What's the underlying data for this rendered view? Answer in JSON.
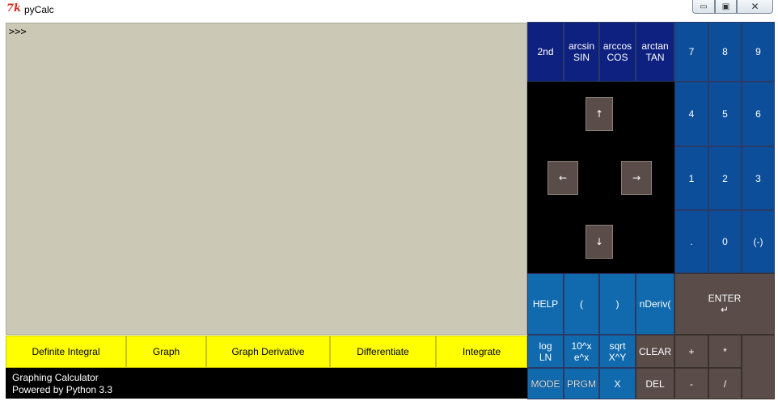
{
  "window": {
    "logo": "7k",
    "title": "pyCalc",
    "minimize_icon": "minimize-icon",
    "maximize_icon": "maximize-icon",
    "close_icon": "close-icon",
    "min_glyph": "▭",
    "max_glyph": "▣",
    "close_glyph": "✕"
  },
  "console": {
    "prompt": ">>>"
  },
  "functions": [
    "Definite Integral",
    "Graph",
    "Graph Derivative",
    "Differentiate",
    "Integrate"
  ],
  "footer": {
    "line1": "Graphing Calculator",
    "line2": "Powered by Python 3.3"
  },
  "keypad": {
    "second": "2nd",
    "arcsin": {
      "top": "arcsin",
      "bottom": "SIN"
    },
    "arccos": {
      "top": "arccos",
      "bottom": "COS"
    },
    "arctan": {
      "top": "arctan",
      "bottom": "TAN"
    },
    "digits": [
      "7",
      "8",
      "9",
      "4",
      "5",
      "6",
      "1",
      "2",
      "3",
      ".",
      "0",
      "(-)"
    ],
    "arrows": {
      "up": "↑",
      "left": "←",
      "right": "→",
      "down": "↓"
    },
    "help": "HELP",
    "lparen": "(",
    "rparen": ")",
    "nderiv": "nDeriv(",
    "enter": {
      "label": "ENTER",
      "glyph": "↵"
    },
    "log": {
      "top": "log",
      "bottom": "LN"
    },
    "tenx": {
      "top": "10^x",
      "bottom": "e^x"
    },
    "sqrt": {
      "top": "sqrt",
      "bottom": "X^Y"
    },
    "clear": "CLEAR",
    "plus": "+",
    "times": "*",
    "mode": "MODE",
    "prgm": "PRGM",
    "x": "X",
    "del": "DEL",
    "minus": "-",
    "divide": "/"
  },
  "colors": {
    "console_bg": "#cbc9b6",
    "function_button": "#ffff00",
    "navy_key": "#0e2180",
    "blue_key": "#0d4e9b",
    "light_blue_key": "#106aad",
    "brown_key": "#5a4c48"
  }
}
